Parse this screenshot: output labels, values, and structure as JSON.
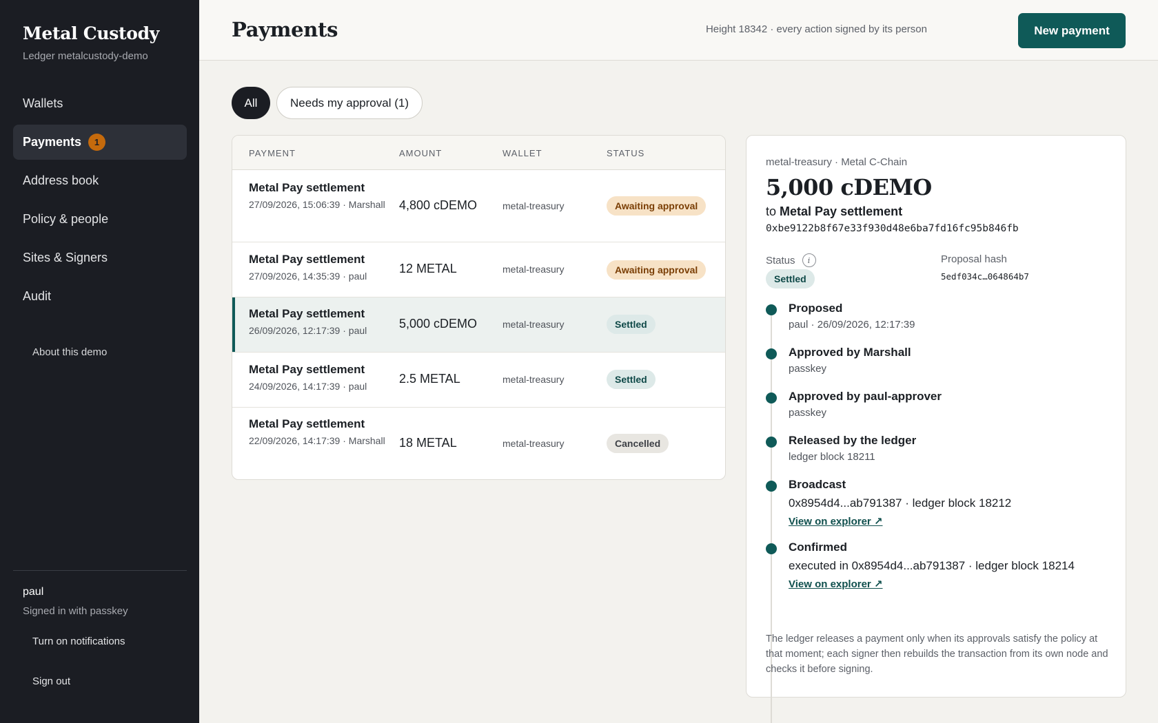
{
  "sidebar": {
    "brand_title": "Metal Custody",
    "brand_sub": "Ledger metalcustody-demo",
    "items": [
      {
        "label": "Wallets"
      },
      {
        "label": "Payments",
        "badge": "1"
      },
      {
        "label": "Address book"
      },
      {
        "label": "Policy & people"
      },
      {
        "label": "Sites & Signers"
      },
      {
        "label": "Audit"
      }
    ],
    "about": "About this demo",
    "user": {
      "name": "paul",
      "sub": "Signed in with passkey"
    },
    "notifications": "Turn on notifications",
    "sign_out": "Sign out"
  },
  "header": {
    "title": "Payments",
    "info": "Height 18342 · every action signed by its person",
    "new_payment": "New payment"
  },
  "filters": {
    "all": "All",
    "needs_approval": "Needs my approval (1)"
  },
  "table": {
    "headers": {
      "payment": "PAYMENT",
      "amount": "AMOUNT",
      "wallet": "WALLET",
      "status": "STATUS"
    },
    "rows": [
      {
        "title": "Metal Pay settlement",
        "meta": "27/09/2026, 15:06:39 · Marshall",
        "amount": "4,800 cDEMO",
        "wallet": "metal-treasury",
        "status": "Awaiting approval",
        "status_kind": "awaiting"
      },
      {
        "title": "Metal Pay settlement",
        "meta": "27/09/2026, 14:35:39 · paul",
        "amount": "12 METAL",
        "wallet": "metal-treasury",
        "status": "Awaiting approval",
        "status_kind": "awaiting"
      },
      {
        "title": "Metal Pay settlement",
        "meta": "26/09/2026, 12:17:39 · paul",
        "amount": "5,000 cDEMO",
        "wallet": "metal-treasury",
        "status": "Settled",
        "status_kind": "settled",
        "selected": true
      },
      {
        "title": "Metal Pay settlement",
        "meta": "24/09/2026, 14:17:39 · paul",
        "amount": "2.5 METAL",
        "wallet": "metal-treasury",
        "status": "Settled",
        "status_kind": "settled"
      },
      {
        "title": "Metal Pay settlement",
        "meta": "22/09/2026, 14:17:39 · Marshall",
        "amount": "18 METAL",
        "wallet": "metal-treasury",
        "status": "Cancelled",
        "status_kind": "cancelled"
      }
    ]
  },
  "detail": {
    "context": "metal-treasury · Metal C-Chain",
    "amount": "5,000 cDEMO",
    "to_prefix": "to",
    "to_name": "Metal Pay settlement",
    "address": "0xbe9122b8f67e33f930d48e6ba7fd16fc95b846fb",
    "status_label": "Status",
    "status": "Settled",
    "hash_label": "Proposal hash",
    "hash": "5edf034c…064864b7",
    "timeline": [
      {
        "title": "Proposed",
        "sub": "paul · 26/09/2026, 12:17:39"
      },
      {
        "title": "Approved by Marshall",
        "sub": "passkey"
      },
      {
        "title": "Approved by paul-approver",
        "sub": "passkey"
      },
      {
        "title": "Released by the ledger",
        "sub": "ledger block 18211"
      },
      {
        "title": "Broadcast",
        "sub": "0x8954d4...ab791387 · ledger block 18212",
        "link": "View on explorer ↗"
      },
      {
        "title": "Confirmed",
        "sub": "executed in 0x8954d4...ab791387 · ledger block 18214",
        "link": "View on explorer ↗"
      }
    ],
    "footnote": "The ledger releases a payment only when its approvals satisfy the policy at that moment; each signer then rebuilds the transaction from its own node and checks it before signing."
  },
  "colors": {
    "sidebar_bg": "#1b1d23",
    "accent": "#0f5a58",
    "badge_orange": "#c56a0c",
    "awaiting_bg": "#f7e2c6",
    "settled_bg": "#dde9e8",
    "cancelled_bg": "#e8e6e1",
    "page_bg": "#f3f2ee"
  }
}
